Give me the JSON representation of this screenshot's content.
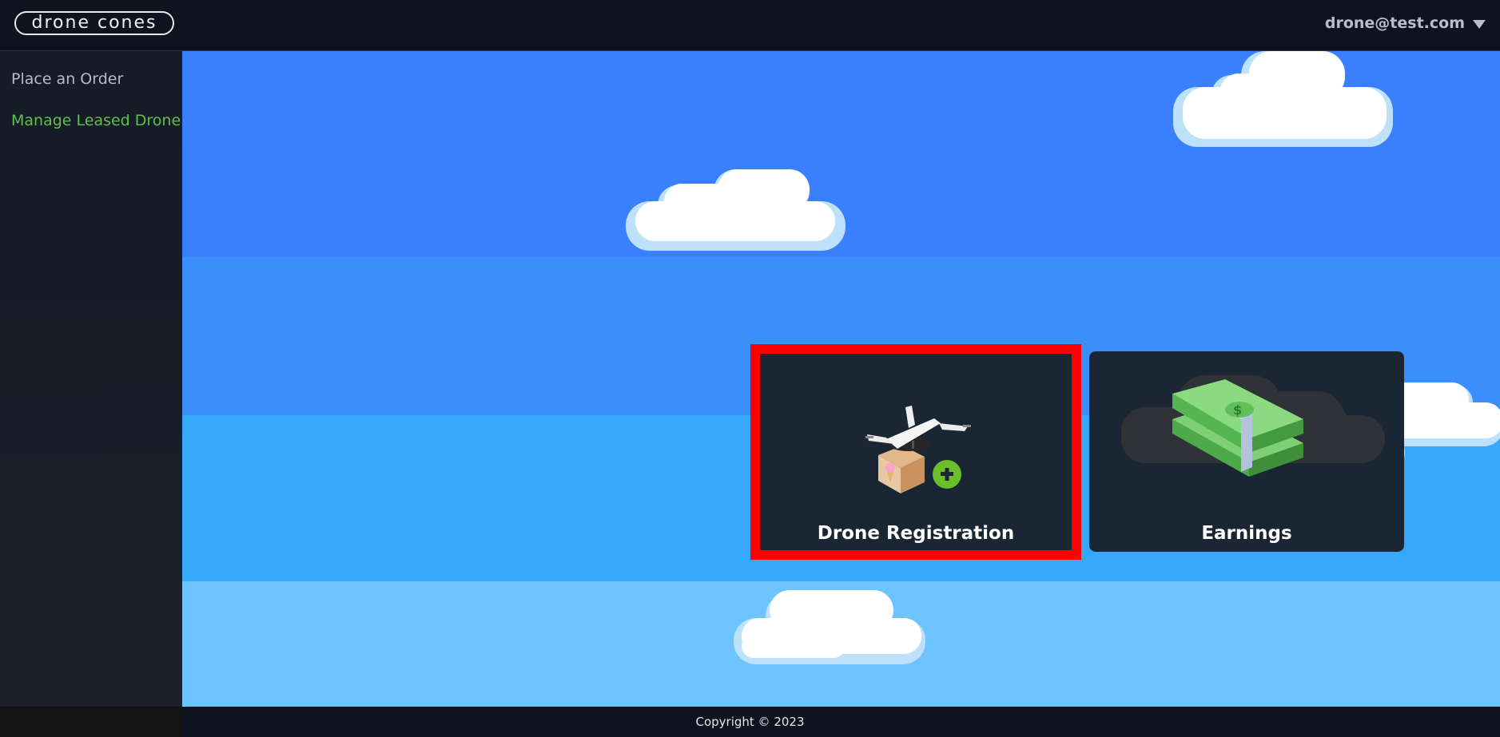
{
  "header": {
    "logo_text": "drone cones",
    "user_email": "drone@test.com"
  },
  "sidebar": {
    "items": [
      {
        "label": "Place an Order",
        "active": false
      },
      {
        "label": "Manage Leased Drone",
        "active": true
      }
    ],
    "active_color": "#5fc04a"
  },
  "cards": [
    {
      "label": "Drone Registration",
      "icon": "drone-plus-icon",
      "highlighted": true
    },
    {
      "label": "Earnings",
      "icon": "money-stack-icon",
      "highlighted": false
    }
  ],
  "colors": {
    "highlight": "#ff0000",
    "card_bg": "#1a2633"
  },
  "footer": {
    "copyright": "Copyright © 2023"
  }
}
